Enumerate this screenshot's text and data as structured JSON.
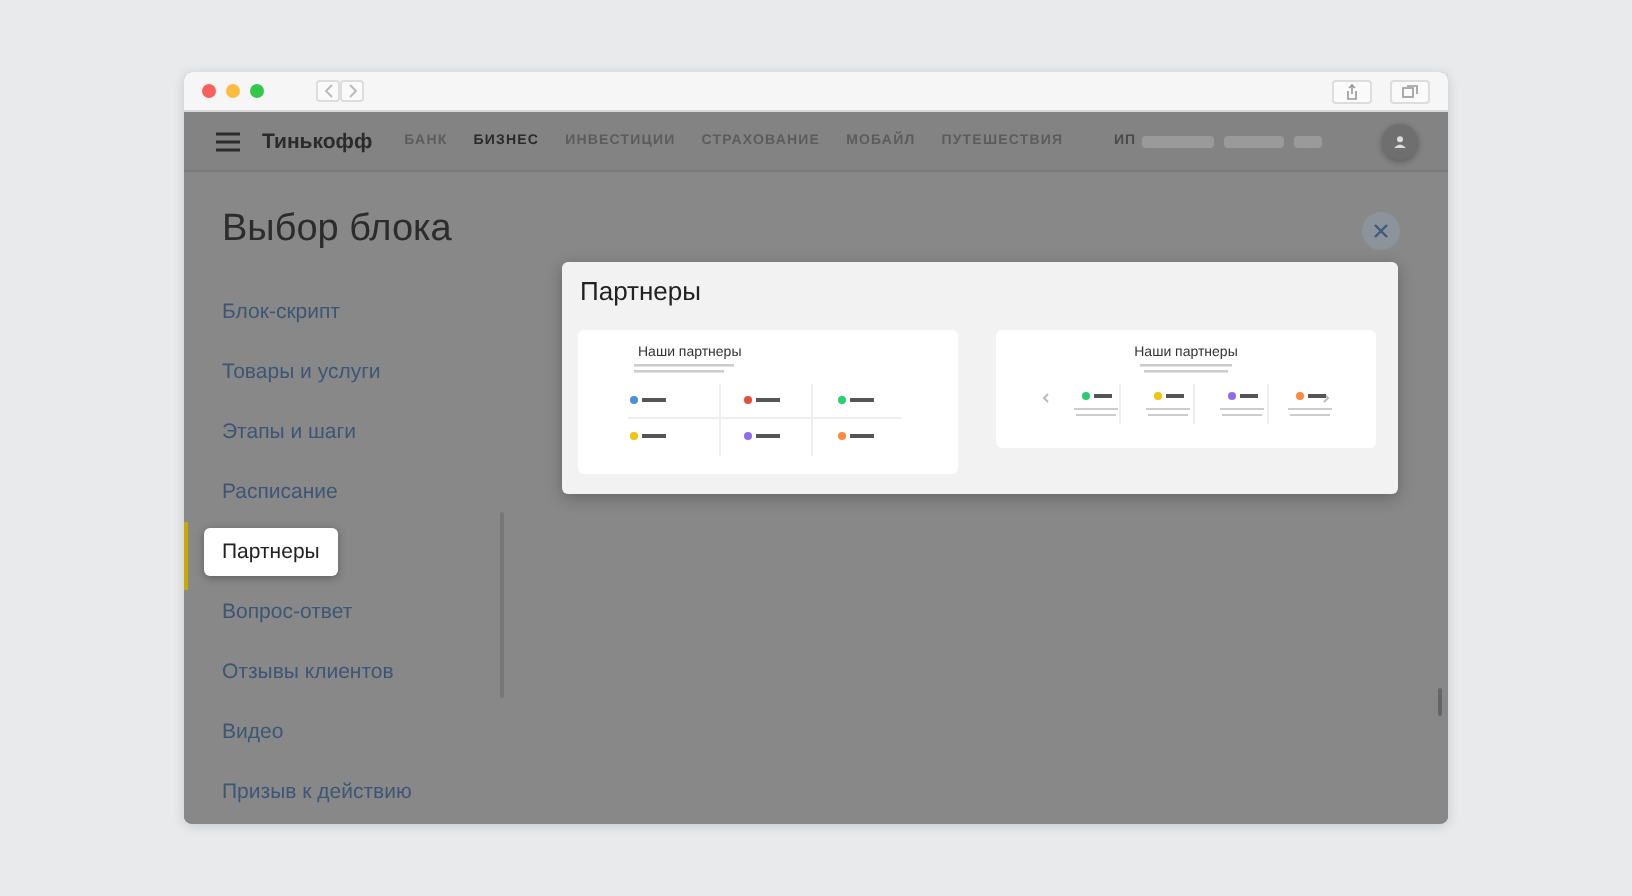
{
  "nav": {
    "brand": "Тинькофф",
    "items": [
      {
        "label": "БАНК",
        "selected": false
      },
      {
        "label": "БИЗНЕС",
        "selected": true
      },
      {
        "label": "ИНВЕСТИЦИИ",
        "selected": false
      },
      {
        "label": "СТРАХОВАНИЕ",
        "selected": false
      },
      {
        "label": "МОБАЙЛ",
        "selected": false
      },
      {
        "label": "ПУТЕШЕСТВИЯ",
        "selected": false
      }
    ],
    "account": "ИП"
  },
  "dialog": {
    "title": "Выбор блока"
  },
  "sidebar": {
    "items": [
      {
        "label": "Блок-скрипт",
        "selected": false
      },
      {
        "label": "Товары и услуги",
        "selected": false
      },
      {
        "label": "Этапы и шаги",
        "selected": false
      },
      {
        "label": "Расписание",
        "selected": false
      },
      {
        "label": "Партнеры",
        "selected": true
      },
      {
        "label": "Вопрос-ответ",
        "selected": false
      },
      {
        "label": "Отзывы клиентов",
        "selected": false
      },
      {
        "label": "Видео",
        "selected": false
      },
      {
        "label": "Призыв к действию",
        "selected": false
      }
    ]
  },
  "preview": {
    "title": "Партнеры",
    "variants": [
      {
        "kind": "grid",
        "heading": "Наши партнеры"
      },
      {
        "kind": "carousel",
        "heading": "Наши партнеры"
      }
    ]
  }
}
